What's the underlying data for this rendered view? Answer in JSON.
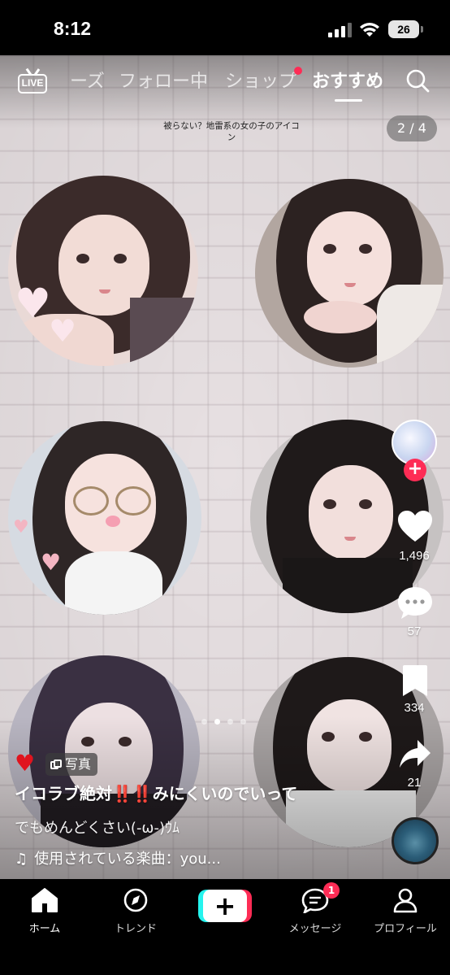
{
  "status_bar": {
    "time": "8:12",
    "battery": "26"
  },
  "top_nav": {
    "live_label": "LIVE",
    "tabs": [
      {
        "label": "ーズ"
      },
      {
        "label": "フォロー中"
      },
      {
        "label": "ショップ"
      },
      {
        "label": "おすすめ"
      }
    ],
    "active_tab": "おすすめ"
  },
  "post": {
    "caption_title": "被らない？地雷系の女の子のアイコン",
    "page_indicator": "2 / 4",
    "type_badge": "写真",
    "title": "イコラブ絶対‼️‼️みにくいのでいって",
    "description": "でもめんどくさい(-ω-)ｳﾑ",
    "music": "使用されている楽曲：you...",
    "likes": "1,496",
    "comments": "57",
    "bookmarks": "334",
    "shares": "21"
  },
  "bottom_nav": {
    "items": [
      {
        "label": "ホーム"
      },
      {
        "label": "トレンド"
      },
      {
        "label": "メッセージ",
        "badge": "1"
      },
      {
        "label": "プロフィール"
      }
    ]
  },
  "colors": {
    "accent": "#fe2c55",
    "cyan": "#25f4ee"
  }
}
